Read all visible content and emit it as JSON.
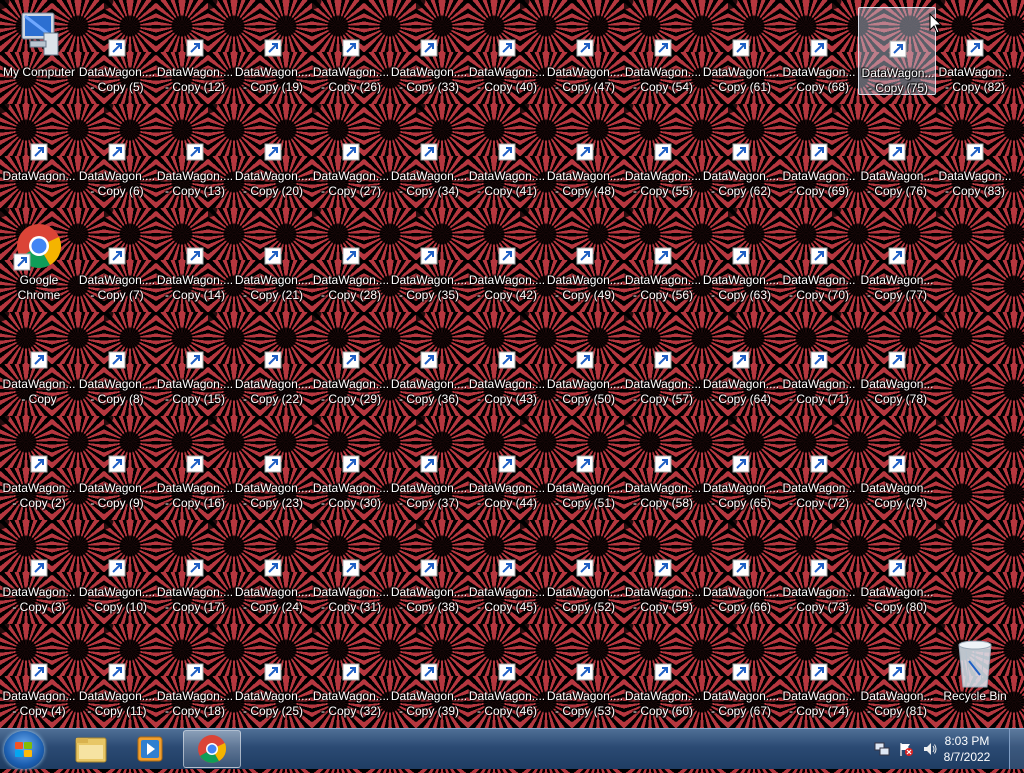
{
  "desktop": {
    "special_icons": [
      {
        "key": "my_computer",
        "label": "My Computer",
        "label2": ""
      },
      {
        "key": "chrome",
        "label": "Google",
        "label2": "Chrome"
      },
      {
        "key": "recycle",
        "label": "Recycle Bin",
        "label2": ""
      }
    ],
    "shortcut_name": "DataWagon....",
    "shortcut_name_alt": "DataWagon...",
    "columns": [
      [
        "My Computer",
        "Copy",
        "Google Chrome",
        "- Copy",
        "- Copy (2)",
        "- Copy (3)",
        "- Copy (4)"
      ],
      [
        "- Copy (5)",
        "- Copy (6)",
        "- Copy (7)",
        "- Copy (8)",
        "- Copy (9)",
        "- Copy (10)",
        "- Copy (11)"
      ],
      [
        "- Copy (12)",
        "- Copy (13)",
        "- Copy (14)",
        "- Copy (15)",
        "- Copy (16)",
        "- Copy (17)",
        "- Copy (18)"
      ],
      [
        "- Copy (19)",
        "- Copy (20)",
        "- Copy (21)",
        "- Copy (22)",
        "- Copy (23)",
        "- Copy (24)",
        "- Copy (25)"
      ],
      [
        "- Copy (26)",
        "- Copy (27)",
        "- Copy (28)",
        "- Copy (29)",
        "- Copy (30)",
        "- Copy (31)",
        "- Copy (32)"
      ],
      [
        "- Copy (33)",
        "- Copy (34)",
        "- Copy (35)",
        "- Copy (36)",
        "- Copy (37)",
        "- Copy (38)",
        "- Copy (39)"
      ],
      [
        "- Copy (40)",
        "- Copy (41)",
        "- Copy (42)",
        "- Copy (43)",
        "- Copy (44)",
        "- Copy (45)",
        "- Copy (46)"
      ],
      [
        "- Copy (47)",
        "- Copy (48)",
        "- Copy (49)",
        "- Copy (50)",
        "- Copy (51)",
        "- Copy (52)",
        "- Copy (53)"
      ],
      [
        "- Copy (54)",
        "- Copy (55)",
        "- Copy (56)",
        "- Copy (57)",
        "- Copy (58)",
        "- Copy (59)",
        "- Copy (60)"
      ],
      [
        "- Copy (61)",
        "- Copy (62)",
        "- Copy (63)",
        "- Copy (64)",
        "- Copy (65)",
        "- Copy (66)",
        "- Copy (67)"
      ],
      [
        "- Copy (68)",
        "- Copy (69)",
        "- Copy (70)",
        "- Copy (71)",
        "- Copy (72)",
        "- Copy (73)",
        "- Copy (74)"
      ],
      [
        "- Copy (75)",
        "- Copy (76)",
        "- Copy (77)",
        "- Copy (78)",
        "- Copy (79)",
        "- Copy (80)",
        "- Copy (81)"
      ],
      [
        "- Copy (82)",
        "- Copy (83)"
      ]
    ],
    "selected_label": "- Copy (75)"
  },
  "taskbar": {
    "clock_time": "8:03 PM",
    "clock_date": "8/7/2022",
    "pinned": [
      "windows-explorer",
      "media-player",
      "google-chrome"
    ]
  },
  "colors": {
    "wallpaper_red": "#b5373f",
    "taskbar_blue": "#2b4a73",
    "shortcut_arrow": "#1e5fc4"
  }
}
